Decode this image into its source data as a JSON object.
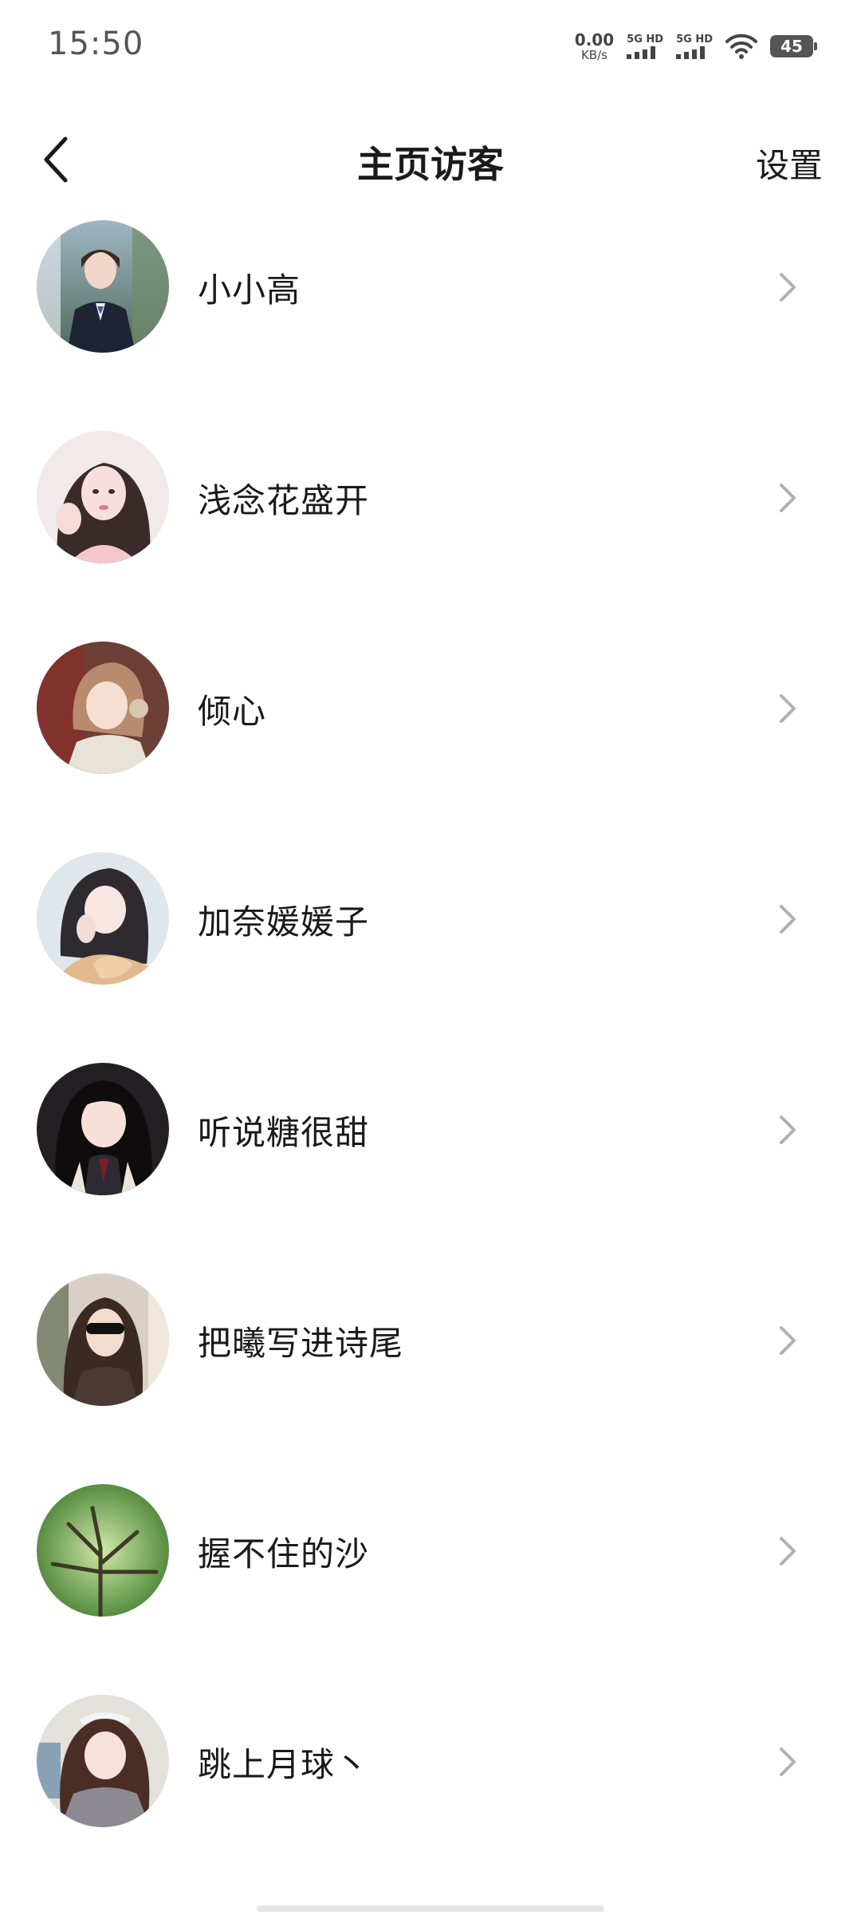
{
  "status_bar": {
    "time": "15:50",
    "net_speed_value": "0.00",
    "net_speed_unit": "KB/s",
    "sim1_label": "5G HD",
    "sim2_label": "5G HD",
    "battery_level": "45",
    "icons": [
      "signal-icon",
      "signal-icon",
      "wifi-icon",
      "battery-icon"
    ]
  },
  "nav": {
    "back_icon": "chevron-left-icon",
    "title": "主页访客",
    "settings_label": "设置"
  },
  "visitors": [
    {
      "name": "小小高"
    },
    {
      "name": "浅念花盛开"
    },
    {
      "name": "倾心"
    },
    {
      "name": "加奈媛媛子"
    },
    {
      "name": "听说糖很甜"
    },
    {
      "name": "把曦写进诗尾"
    },
    {
      "name": "握不住的沙"
    },
    {
      "name": "跳上月球丶"
    }
  ],
  "colors": {
    "text": "#1a1a1a",
    "chevron": "#b0b0b0",
    "background": "#ffffff"
  }
}
